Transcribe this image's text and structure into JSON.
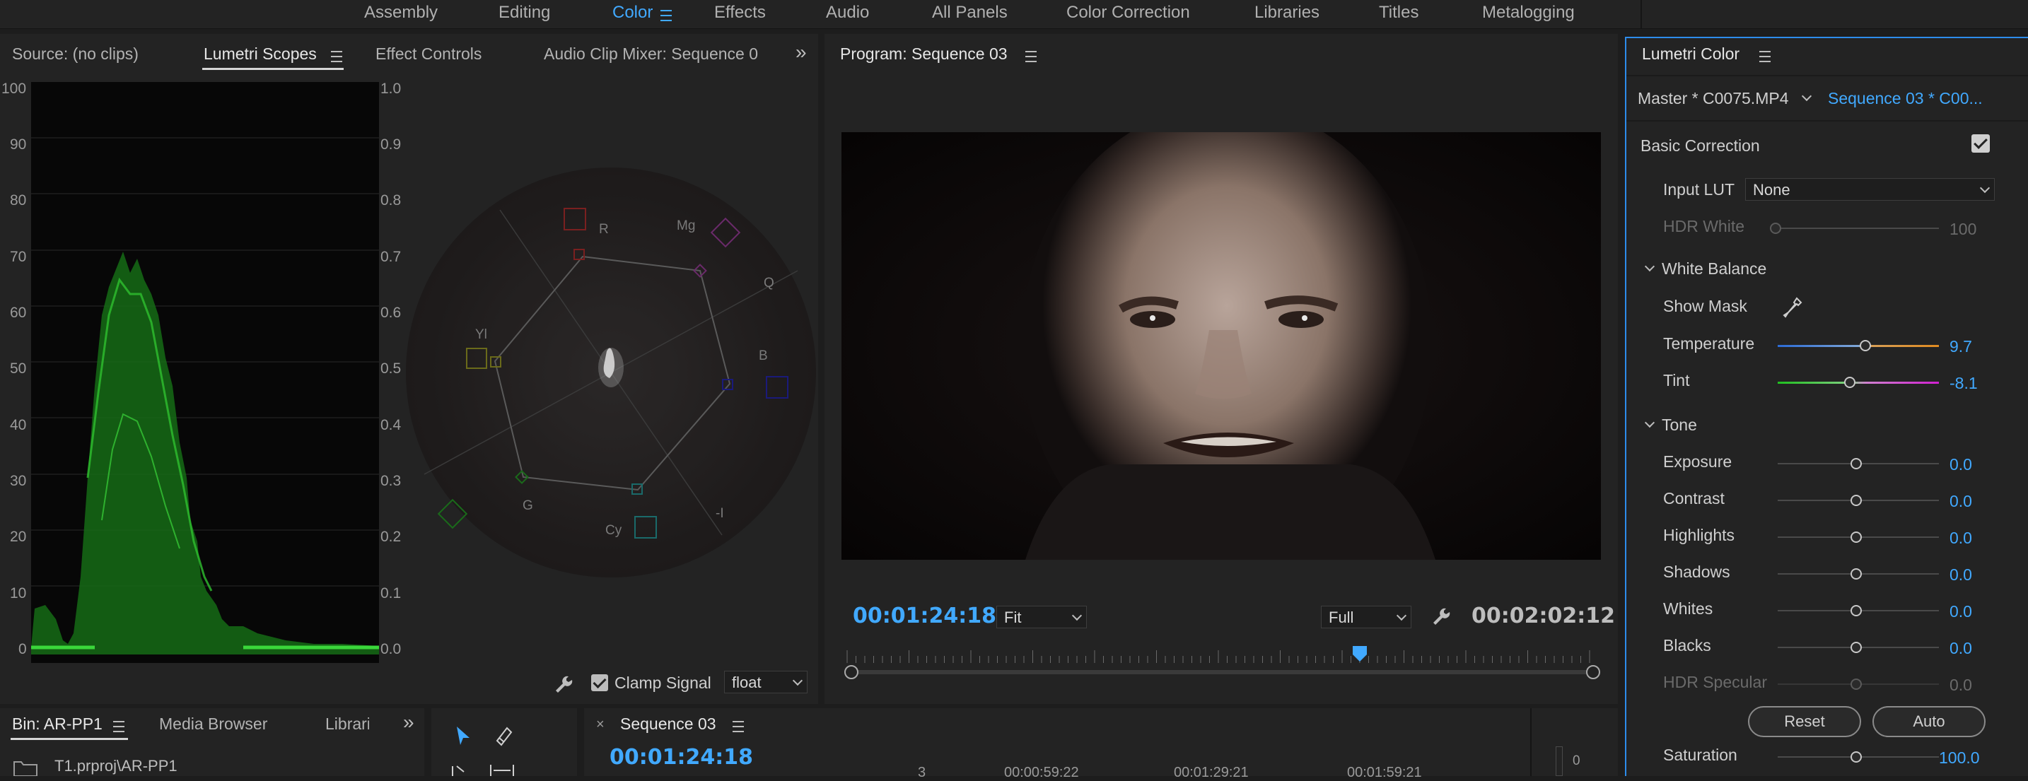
{
  "workspaces": [
    "Assembly",
    "Editing",
    "Color",
    "Effects",
    "Audio",
    "All Panels",
    "Color Correction",
    "Libraries",
    "Titles",
    "Metalogging"
  ],
  "active_workspace": "Color",
  "left_panel": {
    "tabs": [
      "Source: (no clips)",
      "Lumetri Scopes",
      "Effect Controls",
      "Audio Clip Mixer: Sequence 0"
    ],
    "selected_tab": "Lumetri Scopes",
    "waveform_left_scale": [
      "100",
      "90",
      "80",
      "70",
      "60",
      "50",
      "40",
      "30",
      "20",
      "10",
      "0"
    ],
    "waveform_right_scale": [
      "1.0",
      "0.9",
      "0.8",
      "0.7",
      "0.6",
      "0.5",
      "0.4",
      "0.3",
      "0.2",
      "0.1",
      "0.0"
    ],
    "vectorscope_labels": {
      "r": "R",
      "mg": "Mg",
      "q": "Q",
      "b": "B",
      "yl": "Yl",
      "g": "G",
      "cy": "Cy",
      "neg_i": "-I"
    },
    "clamp_signal_label": "Clamp Signal",
    "clamp_signal_checked": true,
    "bit_depth": "float"
  },
  "program_monitor": {
    "title": "Program: Sequence 03",
    "timecode": "00:01:24:18",
    "zoom": "Fit",
    "resolution": "Full",
    "duration": "00:02:02:12",
    "playhead_position": 0.69
  },
  "lumetri_color": {
    "title": "Lumetri Color",
    "master_clip": "Master * C0075.MP4",
    "sequence_clip": "Sequence 03 * C00...",
    "basic_correction": {
      "label": "Basic Correction",
      "enabled": true
    },
    "input_lut": {
      "label": "Input LUT",
      "value": "None"
    },
    "hdr_white": {
      "label": "HDR White",
      "value": "100"
    },
    "white_balance_label": "White Balance",
    "show_mask_label": "Show Mask",
    "temperature": {
      "label": "Temperature",
      "value": "9.7"
    },
    "tint": {
      "label": "Tint",
      "value": "-8.1"
    },
    "tone_label": "Tone",
    "tone_controls": [
      {
        "label": "Exposure",
        "value": "0.0"
      },
      {
        "label": "Contrast",
        "value": "0.0"
      },
      {
        "label": "Highlights",
        "value": "0.0"
      },
      {
        "label": "Shadows",
        "value": "0.0"
      },
      {
        "label": "Whites",
        "value": "0.0"
      },
      {
        "label": "Blacks",
        "value": "0.0"
      },
      {
        "label": "HDR Specular",
        "value": "0.0"
      }
    ],
    "reset_label": "Reset",
    "auto_label": "Auto",
    "saturation": {
      "label": "Saturation",
      "value": "100.0"
    }
  },
  "project_panel": {
    "tabs": [
      "Bin: AR-PP1",
      "Media Browser",
      "Librari"
    ],
    "path": "T1.prproj\\AR-PP1"
  },
  "timeline": {
    "sequence_tab": "Sequence 03",
    "timecode": "00:01:24:18",
    "ruler_marks": [
      "3",
      "00:00:59:22",
      "00:01:29:21",
      "00:01:59:21"
    ],
    "meter_value": "0"
  },
  "colors": {
    "accent": "#41a9ff",
    "panel_bg": "#232323",
    "border_active": "#2d8ceb"
  }
}
